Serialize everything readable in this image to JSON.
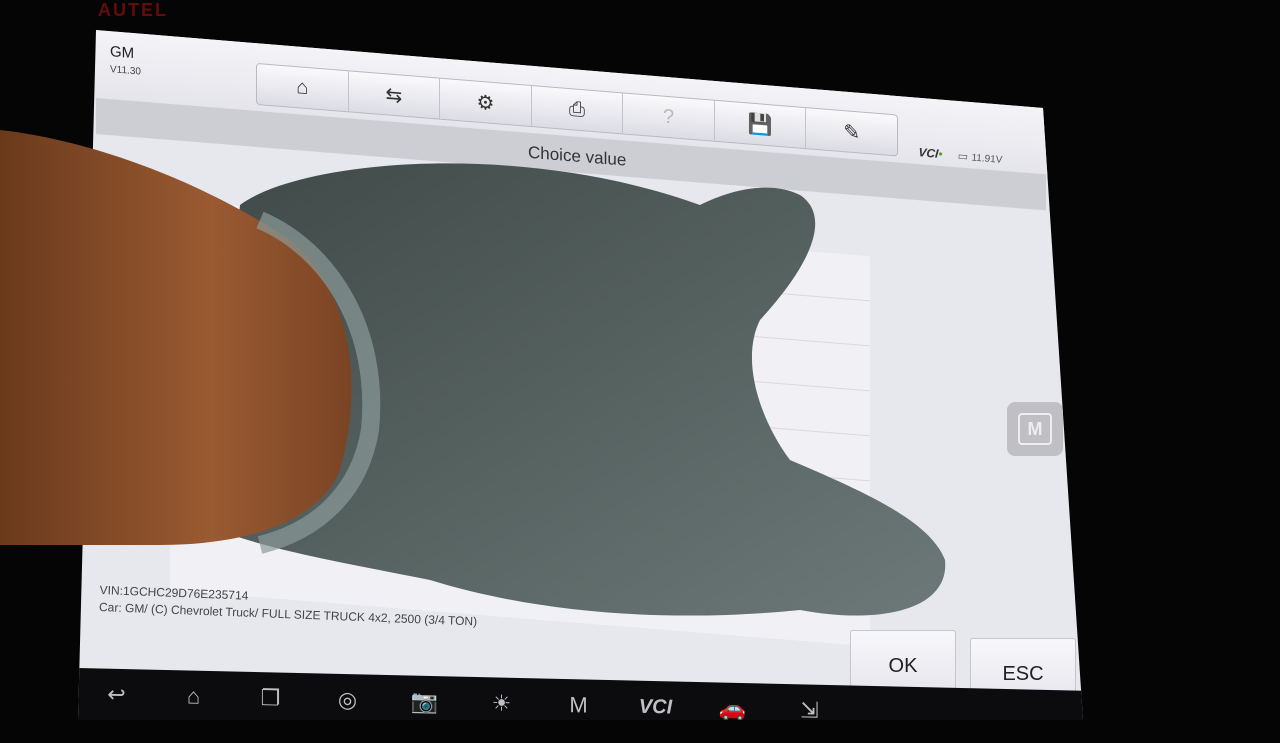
{
  "device": {
    "brand": "AUTEL"
  },
  "app": {
    "name": "GM",
    "version": "V11.30"
  },
  "toolbar": {
    "items": [
      {
        "name": "home",
        "glyph": "⌂"
      },
      {
        "name": "vehicle-swap",
        "glyph": "⇆"
      },
      {
        "name": "settings",
        "glyph": "⚙"
      },
      {
        "name": "print",
        "glyph": "⎙"
      },
      {
        "name": "help",
        "glyph": "?"
      },
      {
        "name": "save",
        "glyph": "💾"
      },
      {
        "name": "edit",
        "glyph": "✎"
      }
    ]
  },
  "page": {
    "title": "Choice value"
  },
  "status": {
    "vci": "VCI",
    "battery": "11.91V"
  },
  "menu_button": {
    "glyph": "M"
  },
  "vehicle": {
    "vin": "VIN:1GCHC29D76E235714",
    "car": "Car: GM/ (C) Chevrolet Truck/ FULL SIZE TRUCK 4x2, 2500 (3/4 TON)"
  },
  "buttons": {
    "ok": "OK",
    "esc": "ESC"
  },
  "nav": {
    "back": "↩",
    "home": "⌂",
    "recent": "❐",
    "browser": "◎",
    "camera": "📷",
    "display": "☀",
    "maxifix": "M",
    "vci": "VCI",
    "car": "🚗",
    "remote": "⇲"
  },
  "colors": {
    "accent": "#5a9a20",
    "screen_bg": "#e7e7ee",
    "toolbar_bg": "#f4f4f8"
  }
}
